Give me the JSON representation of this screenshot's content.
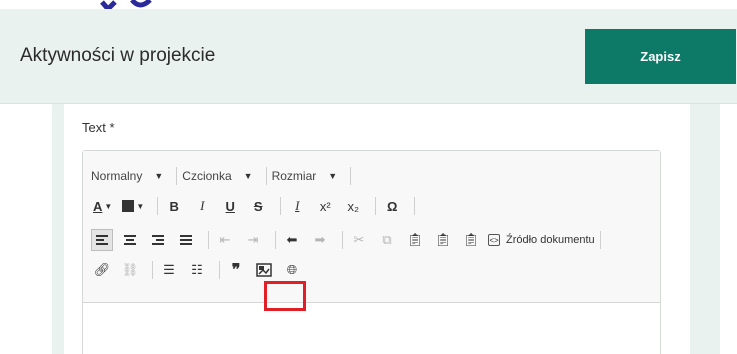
{
  "header": {
    "title": "Aktywności w projekcie",
    "save_label": "Zapisz"
  },
  "form": {
    "field_label": "Text *"
  },
  "toolbar": {
    "row1": {
      "format": "Normalny",
      "font": "Czcionka",
      "size": "Rozmiar"
    },
    "row2": {
      "text_color_letter": "A",
      "bold": "B",
      "italic": "I",
      "underline": "U",
      "strike": "S",
      "remove_format": "I",
      "superscript": "x²",
      "subscript": "x₂",
      "special_char": "Ω"
    },
    "row3": {
      "source_label": "Źródło dokumentu"
    },
    "row4": {
      "quote": "❞"
    }
  },
  "colors": {
    "accent": "#0d7a68",
    "header_bg": "#e9f2ee",
    "highlight": "#e21f26"
  }
}
